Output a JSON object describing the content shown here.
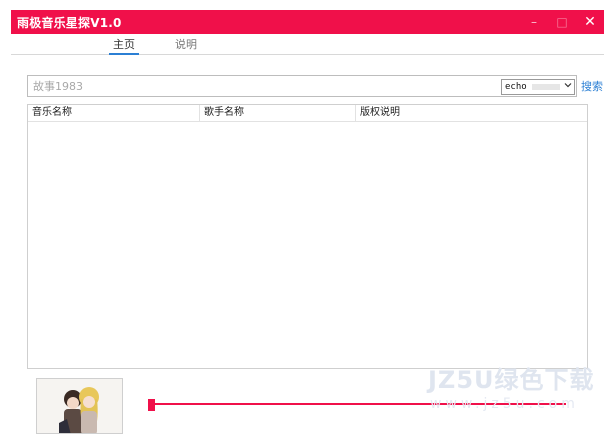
{
  "window": {
    "title": "雨极音乐星探V1.0",
    "controls": {
      "minimize": "–",
      "maximize": "□",
      "close": "✕"
    },
    "accent_color": "#f0104a"
  },
  "tabs": [
    {
      "label": "主页",
      "active": true
    },
    {
      "label": "说明",
      "active": false
    }
  ],
  "search": {
    "placeholder": "故事1983",
    "source": {
      "selected": "echo"
    },
    "button_label": "搜索"
  },
  "table": {
    "columns": [
      "音乐名称",
      "歌手名称",
      "版权说明"
    ],
    "rows": []
  },
  "player": {
    "progress": 0,
    "album_art_icon": "anime-characters-album-art"
  },
  "watermark": {
    "brand": "JZ5U绿色下载",
    "url": "www.jz5u.com"
  }
}
